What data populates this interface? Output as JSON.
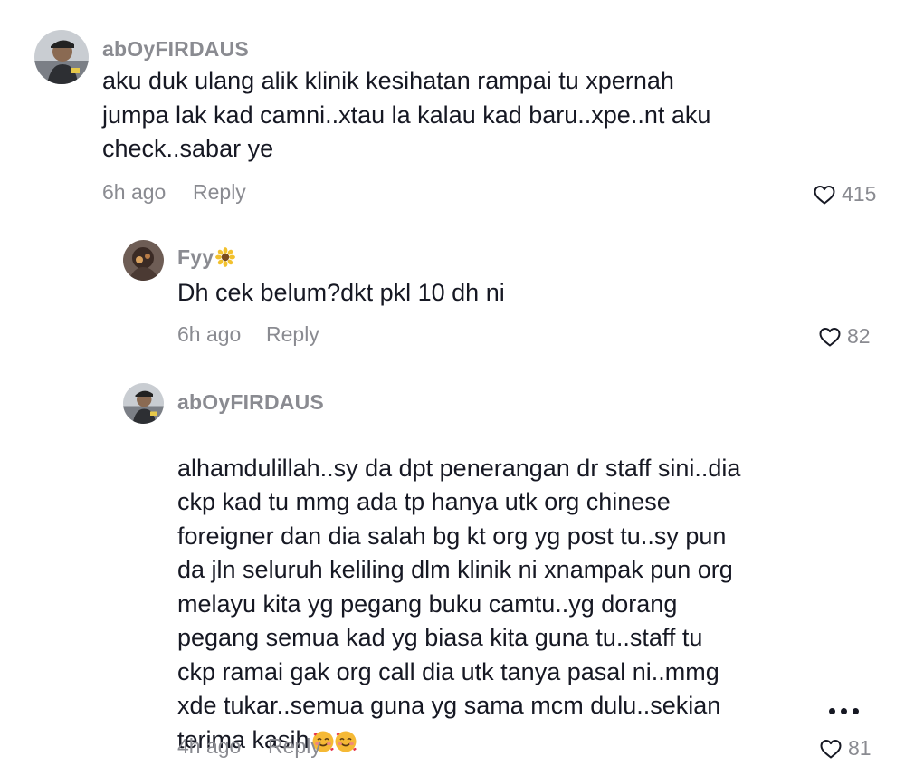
{
  "comments": [
    {
      "username": "abOyFIRDAUS",
      "text": "aku duk ulang alik klinik kesihatan rampai tu xpernah\njumpa lak kad camni..xtau la kalau kad baru..xpe..nt aku\ncheck..sabar ye",
      "time": "6h ago",
      "reply_label": "Reply",
      "likes": "415"
    },
    {
      "username": "Fyy",
      "text": "Dh cek belum?dkt pkl 10 dh ni",
      "time": "6h ago",
      "reply_label": "Reply",
      "likes": "82"
    },
    {
      "username": "abOyFIRDAUS",
      "text": "alhamdulillah..sy da dpt penerangan dr staff sini..dia\nckp kad tu mmg ada tp hanya utk org chinese\nforeigner dan dia salah bg kt org yg post tu..sy pun\nda jln seluruh keliling dlm klinik ni xnampak pun org\nmelayu kita yg pegang buku camtu..yg dorang\npegang semua kad yg biasa kita guna tu..staff tu\nckp ramai gak org call dia utk tanya pasal ni..mmg\nxde tukar..semua guna yg sama mcm dulu..sekian\nterima kasih",
      "time": "4h ago",
      "reply_label": "Reply",
      "likes": "81"
    }
  ],
  "icons": {
    "like": "heart-outline-icon",
    "more": "more-options-icon",
    "username_emoji": "sunflower-emoji",
    "text_emoji": "smiling-face-with-hearts-emoji"
  },
  "colors": {
    "text": "#161823",
    "muted": "#8a8b91",
    "background": "#ffffff"
  }
}
